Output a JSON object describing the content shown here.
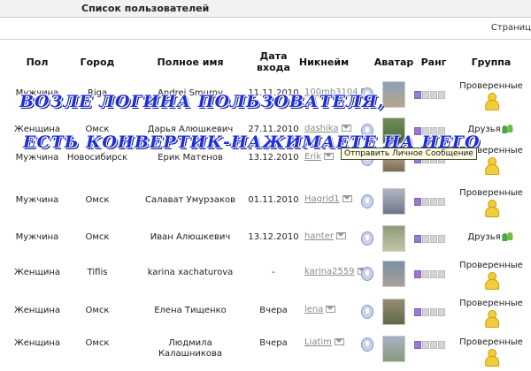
{
  "header": {
    "title": "Список пользователей",
    "pages_label": "Страниц"
  },
  "columns": {
    "gender": "Пол",
    "city": "Город",
    "fullname": "Полное имя",
    "date_line1": "Дата",
    "date_line2": "входа",
    "nick": "Никнейм",
    "avatar": "Аватар",
    "rank": "Ранг",
    "group": "Группа"
  },
  "rows": [
    {
      "gender": "Мужчина",
      "city": "Riga",
      "fullname": "Andrei Smurov",
      "fullname2": "",
      "date": "11.11.2010",
      "nick": "100mb3104",
      "group": "Проверенные"
    },
    {
      "gender": "Женщина",
      "city": "Омск",
      "fullname": "Дарья Алюшкевич",
      "fullname2": "",
      "date": "27.11.2010",
      "nick": "dashika",
      "group": "Друзья"
    },
    {
      "gender": "Мужчина",
      "city": "Новосибирск",
      "fullname": "Ерик Матенов",
      "fullname2": "",
      "date": "13.12.2010",
      "nick": "Erik",
      "group": "Проверенные"
    },
    {
      "gender": "Мужчина",
      "city": "Омск",
      "fullname": "Салават Умурзаков",
      "fullname2": "",
      "date": "01.11.2010",
      "nick": "Hagrid1",
      "group": "Проверенные"
    },
    {
      "gender": "Мужчина",
      "city": "Омск",
      "fullname": "Иван Алюшкевич",
      "fullname2": "",
      "date": "13.12.2010",
      "nick": "hanter",
      "group": "Друзья"
    },
    {
      "gender": "Женщина",
      "city": "Tiflis",
      "fullname": "karina xachaturova",
      "fullname2": "",
      "date": "-",
      "nick": "karina2559",
      "group": "Проверенные"
    },
    {
      "gender": "Женщина",
      "city": "Омск",
      "fullname": "Елена Тищенко",
      "fullname2": "",
      "date": "Вчера",
      "nick": "lena",
      "group": "Проверенные"
    },
    {
      "gender": "Женщина",
      "city": "Омск",
      "fullname": "Людмила",
      "fullname2": "Калашникова",
      "date": "Вчера",
      "nick": "Liatim",
      "group": "Проверенные"
    }
  ],
  "rank": [
    {
      "level": 1,
      "max": 4
    },
    {
      "level": 1,
      "max": 4
    },
    {
      "level": 1,
      "max": 4
    },
    {
      "level": 1,
      "max": 4
    },
    {
      "level": 1,
      "max": 4
    },
    {
      "level": 1,
      "max": 4
    },
    {
      "level": 1,
      "max": 4
    },
    {
      "level": 1,
      "max": 4
    }
  ],
  "overlay": {
    "line1": "ВОЗЛЕ ЛОГИНА ПОЛЬЗОВАТЕЛЯ,",
    "line2": "ЕСТЬ КОНВЕРТИК-НАЖИМАЕТЕ НА НЕГО"
  },
  "tooltip": "Отправить Личное Сообщение",
  "icons": {
    "mail": "envelope-icon",
    "status": "status-icon",
    "group_verified": "user-icon",
    "group_friends": "friends-icon"
  },
  "colors": {
    "overlay_text": "#1e2fd8",
    "rank_on": "#9a7ad0",
    "nick_link": "#8a8a8a"
  }
}
